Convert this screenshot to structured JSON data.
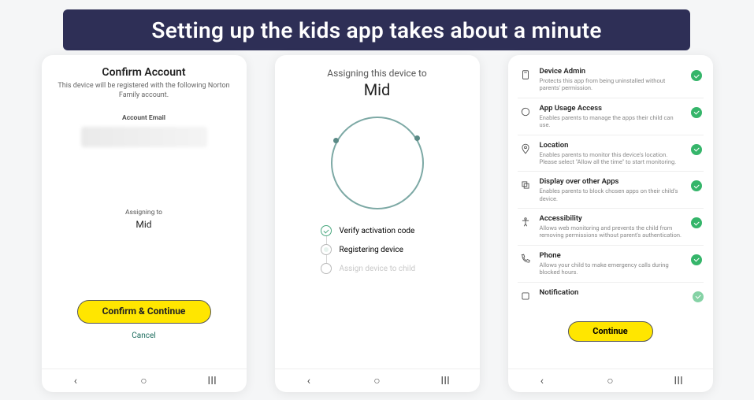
{
  "banner": "Setting up the kids app takes about a minute",
  "screen1": {
    "title": "Confirm Account",
    "subtitle": "This device will be registered with the following Norton Family account.",
    "email_label": "Account Email",
    "assigning_label": "Assigning to",
    "child_name": "Mid",
    "confirm_button": "Confirm & Continue",
    "cancel": "Cancel"
  },
  "screen2": {
    "title": "Assigning this device to",
    "child_name": "Mid",
    "steps": [
      {
        "label": "Verify activation code",
        "state": "done"
      },
      {
        "label": "Registering device",
        "state": "active"
      },
      {
        "label": "Assign device to child",
        "state": "pending"
      }
    ]
  },
  "screen3": {
    "permissions": [
      {
        "icon": "device-admin-icon",
        "title": "Device Admin",
        "desc": "Protects this app from being uninstalled without parents' permission."
      },
      {
        "icon": "app-usage-icon",
        "title": "App Usage Access",
        "desc": "Enables parents to manage the apps their child can use."
      },
      {
        "icon": "location-icon",
        "title": "Location",
        "desc": "Enables parents to monitor this device's location. Please select \"Allow all the time\" to start monitoring."
      },
      {
        "icon": "overlay-icon",
        "title": "Display over other Apps",
        "desc": "Enables parents to block chosen apps on their child's device."
      },
      {
        "icon": "accessibility-icon",
        "title": "Accessibility",
        "desc": "Allows web monitoring and prevents the child from removing permissions without parent's authentication."
      },
      {
        "icon": "phone-icon",
        "title": "Phone",
        "desc": "Allows your child to make emergency calls during blocked hours."
      },
      {
        "icon": "notification-icon",
        "title": "Notification",
        "desc": ""
      }
    ],
    "continue_button": "Continue"
  },
  "nav": {
    "back": "‹",
    "home": "○",
    "recent": "III"
  }
}
